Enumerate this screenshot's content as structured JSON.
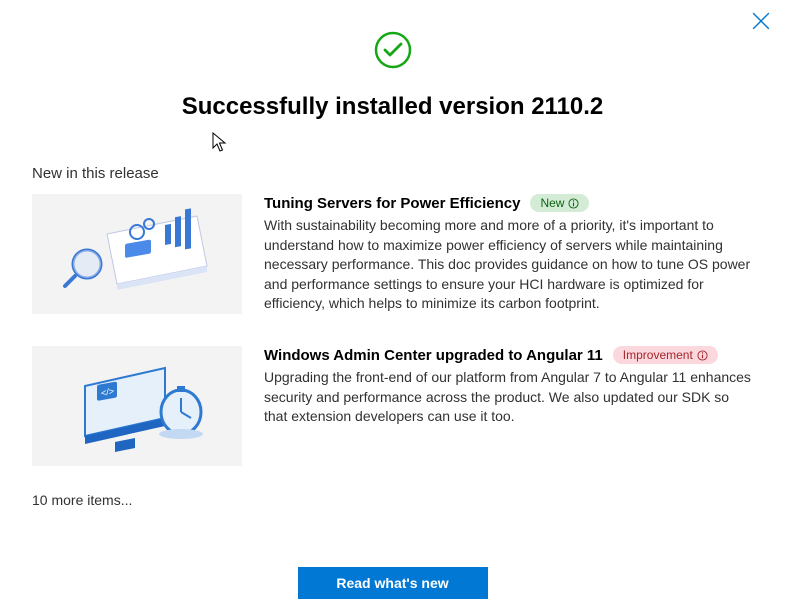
{
  "title": "Successfully installed version 2110.2",
  "section_label": "New in this release",
  "items": [
    {
      "title": "Tuning Servers for Power Efficiency",
      "badge": "New",
      "badge_type": "new",
      "desc": "With sustainability becoming more and more of a priority, it's important to understand how to maximize power efficiency of servers while maintaining necessary performance. This doc provides guidance on how to tune OS power and performance settings to ensure your HCI hardware is optimized for efficiency, which helps to minimize its carbon footprint."
    },
    {
      "title": "Windows Admin Center upgraded to Angular 11",
      "badge": "Improvement",
      "badge_type": "improvement",
      "desc": "Upgrading the front-end of our platform from Angular 7 to Angular 11 enhances security and performance across the product. We also updated our SDK so that extension developers can use it too."
    }
  ],
  "more_items_label": "10 more items...",
  "primary_button": "Read what's new"
}
